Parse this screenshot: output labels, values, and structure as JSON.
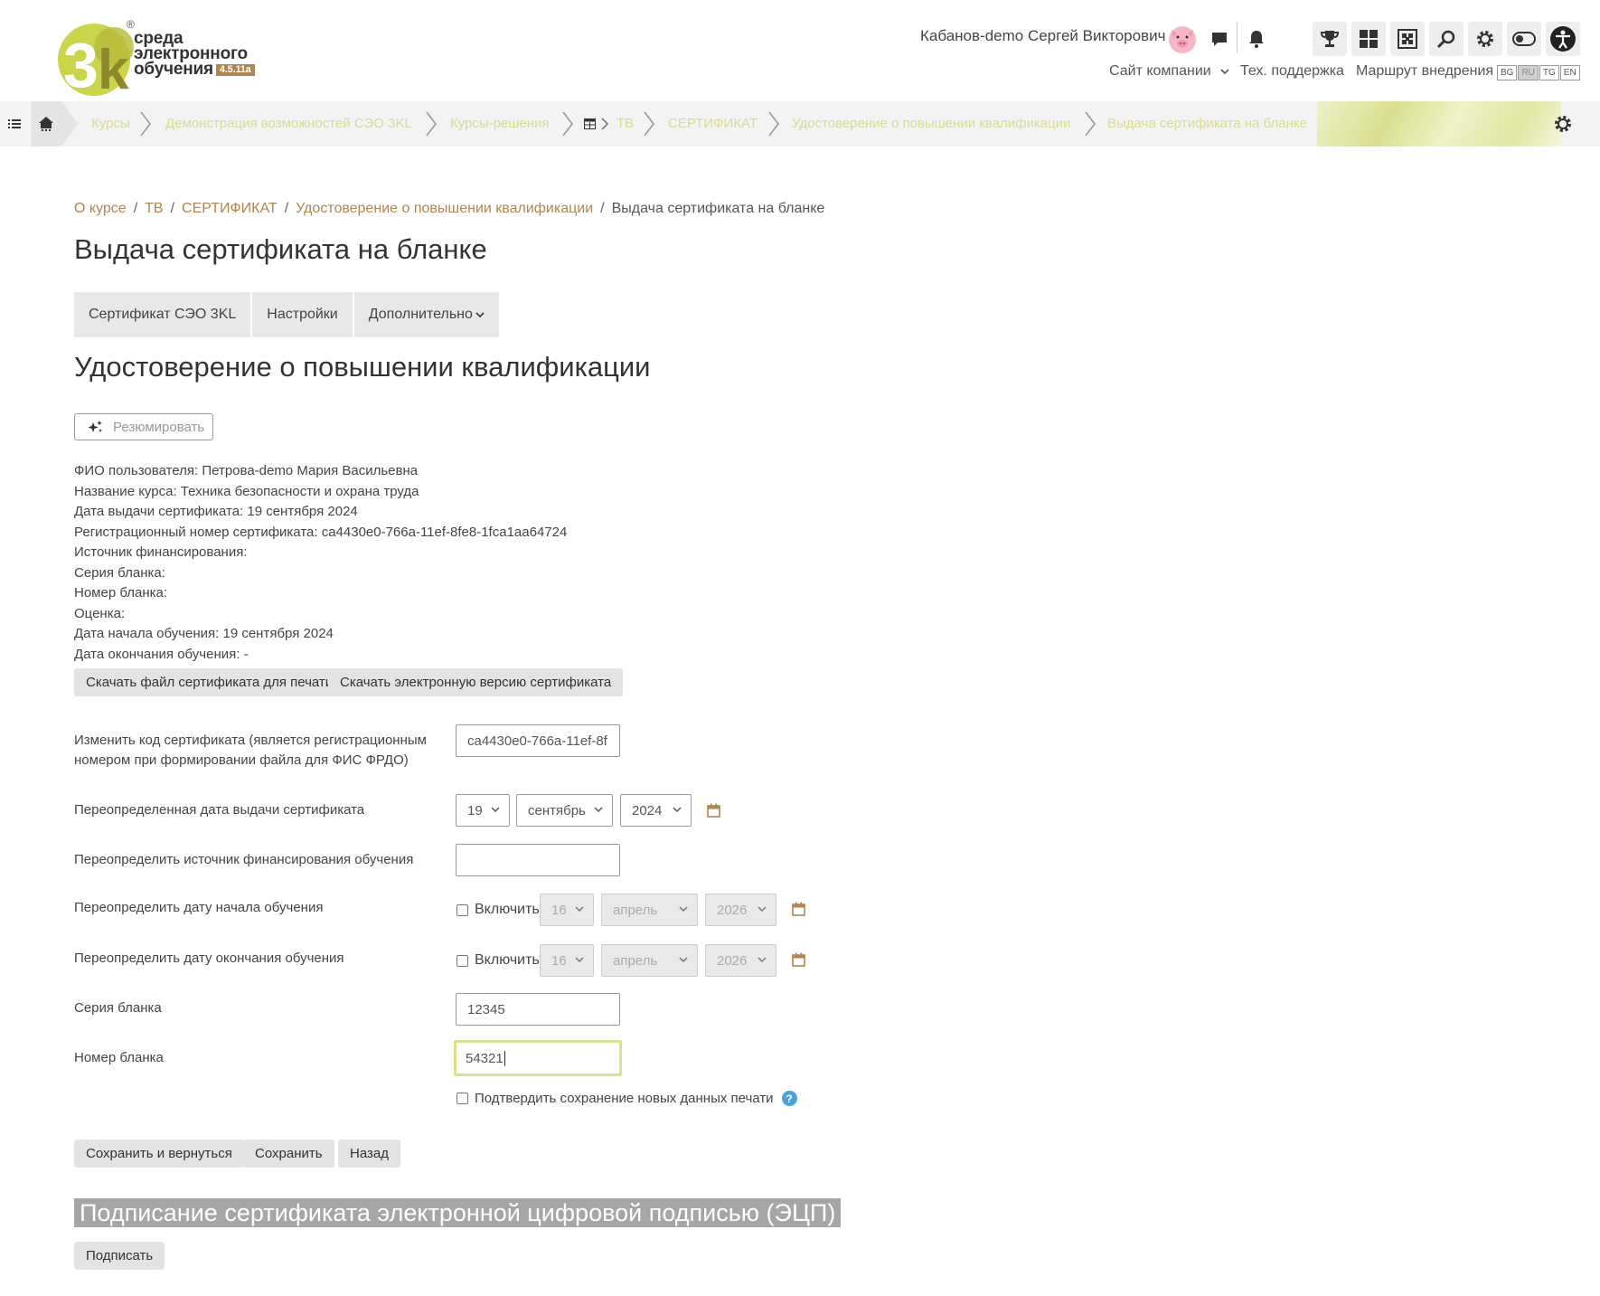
{
  "header": {
    "logo_text_line1": "среда",
    "logo_text_line2": "электронного",
    "logo_text_line3": "обучения",
    "version": "4.5.11a",
    "registered_mark": "®",
    "user_name": "Кабанов-demo Сергей Викторович",
    "links": {
      "company_site": "Сайт компании",
      "support": "Тех. поддержка",
      "route": "Маршрут внедрения"
    },
    "languages": [
      "BG",
      "RU",
      "TG",
      "EN"
    ],
    "active_language": "RU",
    "icons": [
      "chat-icon",
      "bell-icon",
      "trophy-icon",
      "dashboard-icon",
      "puzzle-icon",
      "search-icon",
      "gear-icon",
      "theme-toggle-icon",
      "accessibility-icon"
    ]
  },
  "navbar": {
    "crumbs": [
      "Курсы",
      "Демонстрация возможностей СЭО 3KL",
      "Курсы-решения",
      "ТВ",
      "СЕРТИФИКАТ",
      "Удостоверение о повышении квалификации",
      "Выдача сертификата на бланке"
    ]
  },
  "breadcrumb": {
    "items": [
      "О курсе",
      "ТВ",
      "СЕРТИФИКАТ",
      "Удостоверение о повышении квалификации"
    ],
    "current": "Выдача сертификата на бланке",
    "separator": "/"
  },
  "page": {
    "title": "Выдача сертификата на бланке",
    "tabs": [
      "Сертификат СЭО 3KL",
      "Настройки",
      "Дополнительно"
    ],
    "section_title": "Удостоверение о повышении квалификации",
    "resume_button": "Резюмировать"
  },
  "info": {
    "lines": [
      "ФИО пользователя: Петрова-demo Мария Васильевна",
      "Название курса: Техника безопасности и охрана труда",
      "Дата выдачи сертификата: 19 сентября 2024",
      "Регистрационный номер сертификата: ca4430e0-766a-11ef-8fe8-1fca1aa64724",
      "Источник финансирования:",
      "Серия бланка:",
      "Номер бланка:",
      "Оценка:",
      "Дата начала обучения: 19 сентября 2024",
      "Дата окончания обучения: -"
    ],
    "download_print": "Скачать файл сертификата для печати",
    "download_electronic": "Скачать электронную версию сертификата"
  },
  "form": {
    "code_label_1": "Изменить код сертификата (является регистрационным",
    "code_label_2": "номером при формировании файла для ФИС ФРДО)",
    "code_value": "ca4430e0-766a-11ef-8f",
    "issue_date_label": "Переопределенная дата выдачи сертификата",
    "issue_day": "19",
    "issue_month": "сентябрь",
    "issue_year": "2024",
    "funding_label": "Переопределить источник финансирования обучения",
    "funding_value": "",
    "start_label": "Переопределить дату начала обучения",
    "end_label": "Переопределить дату окончания обучения",
    "enable_label": "Включить",
    "disabled_day": "16",
    "disabled_month": "апрель",
    "disabled_year": "2026",
    "series_label": "Серия бланка",
    "series_value": "12345",
    "number_label": "Номер бланка",
    "number_value": "54321",
    "confirm_label": "Подтвердить сохранение новых данных печати",
    "help_mark": "?",
    "save_return": "Сохранить и вернуться",
    "save": "Сохранить",
    "back": "Назад"
  },
  "signature": {
    "title": "Подписание сертификата электронной цифровой подписью (ЭЦП)",
    "sign_button": "Подписать"
  },
  "colors": {
    "accent_link": "#b08553",
    "crumb_text": "#d7da92",
    "logo_green": "#c7d24a",
    "logo_olive": "#8e8a2c",
    "focus_border": "#dfe08c"
  }
}
